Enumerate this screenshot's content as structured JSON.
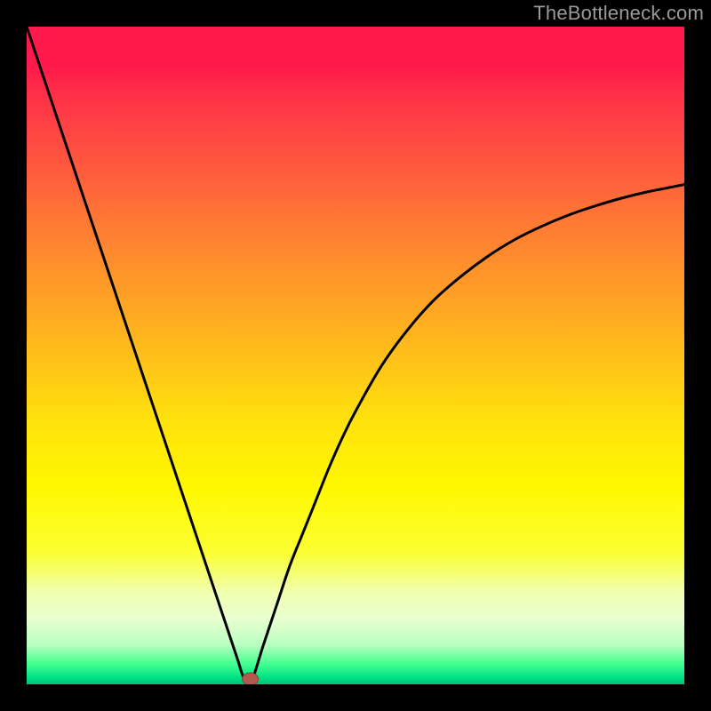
{
  "watermark": "TheBottleneck.com",
  "chart_data": {
    "type": "line",
    "title": "",
    "xlabel": "",
    "ylabel": "",
    "xlim": [
      0,
      100
    ],
    "ylim": [
      0,
      100
    ],
    "series": [
      {
        "name": "bottleneck-curve",
        "x": [
          0,
          2,
          4,
          6,
          8,
          10,
          12,
          14,
          16,
          18,
          20,
          22,
          24,
          26,
          28,
          30,
          32,
          33,
          34,
          36,
          38,
          40,
          42,
          44,
          46,
          48,
          50,
          54,
          58,
          62,
          66,
          70,
          74,
          78,
          82,
          86,
          90,
          94,
          98,
          100
        ],
        "values": [
          100,
          94,
          88,
          82,
          76,
          70,
          64,
          58,
          52,
          46,
          40,
          34,
          28,
          22,
          16,
          10,
          4,
          1,
          0,
          6,
          12,
          18,
          23,
          28,
          33,
          37.5,
          41.5,
          48.5,
          54,
          58.5,
          62,
          65,
          67.5,
          69.5,
          71.2,
          72.6,
          73.8,
          74.8,
          75.6,
          76
        ]
      }
    ],
    "minimum_marker": {
      "x": 34,
      "y": 0
    },
    "background_gradient": {
      "top": "#ff1a4b",
      "middle": "#ffe20d",
      "bottom": "#00c074"
    }
  }
}
